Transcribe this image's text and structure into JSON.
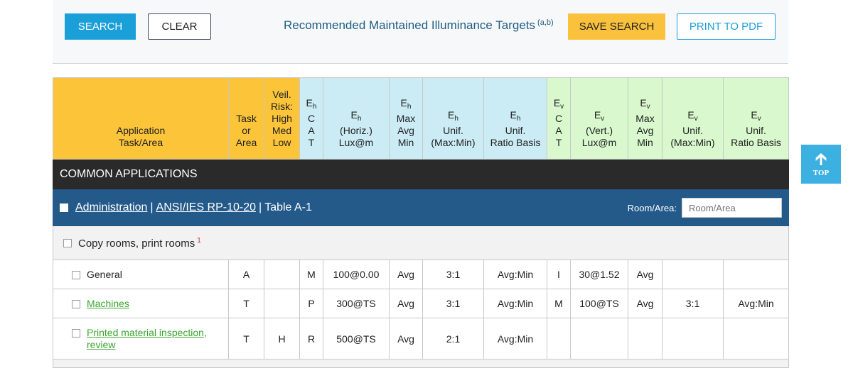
{
  "toolbar": {
    "search_label": "SEARCH",
    "clear_label": "CLEAR",
    "title": "Recommended Maintained Illuminance Targets",
    "title_note": "(a,b)",
    "save_label": "SAVE SEARCH",
    "print_label": "PRINT TO PDF"
  },
  "headers": {
    "application": [
      "Application",
      "Task/Area"
    ],
    "task_area": [
      "Task",
      "or",
      "Area"
    ],
    "veil_risk": [
      "Veil.",
      "Risk:",
      "High",
      "Med",
      "Low"
    ],
    "eh_cat": {
      "sym": "E",
      "sub": "h",
      "lines": [
        "C",
        "A",
        "T"
      ]
    },
    "eh_lux": {
      "sym": "E",
      "sub": "h",
      "lines": [
        "(Horiz.)",
        "Lux@m"
      ]
    },
    "eh_maxavg": {
      "sym": "E",
      "sub": "h",
      "lines": [
        "Max",
        "Avg",
        "Min"
      ]
    },
    "eh_unif": {
      "sym": "E",
      "sub": "h",
      "lines": [
        "Unif.",
        "(Max:Min)"
      ]
    },
    "eh_ratio": {
      "sym": "E",
      "sub": "h",
      "lines": [
        "Unif.",
        "Ratio Basis"
      ]
    },
    "ev_cat": {
      "sym": "E",
      "sub": "v",
      "lines": [
        "C",
        "A",
        "T"
      ]
    },
    "ev_lux": {
      "sym": "E",
      "sub": "v",
      "lines": [
        "(Vert.)",
        "Lux@m"
      ]
    },
    "ev_maxavg": {
      "sym": "E",
      "sub": "v",
      "lines": [
        "Max",
        "Avg",
        "Min"
      ]
    },
    "ev_unif": {
      "sym": "E",
      "sub": "v",
      "lines": [
        "Unif.",
        "(Max:Min)"
      ]
    },
    "ev_ratio": {
      "sym": "E",
      "sub": "v",
      "lines": [
        "Unif.",
        "Ratio Basis"
      ]
    }
  },
  "section": {
    "title": "COMMON APPLICATIONS"
  },
  "group": {
    "link1": "Administration",
    "sep1": "|",
    "link2": "ANSI/IES RP-10-20",
    "sep2": "|",
    "table_ref": "Table A-1",
    "room_label": "Room/Area:",
    "room_placeholder": "Room/Area"
  },
  "subgroup": {
    "label": "Copy rooms, print rooms",
    "footnote": "1"
  },
  "rows": [
    {
      "name": "General",
      "link": false,
      "task": "A",
      "veil": "",
      "eh_cat": "M",
      "eh_lux": "100@0.00",
      "eh_maxavg": "Avg",
      "eh_unif": "3:1",
      "eh_ratio": "Avg:Min",
      "ev_cat": "I",
      "ev_lux": "30@1.52",
      "ev_maxavg": "Avg",
      "ev_unif": "",
      "ev_ratio": ""
    },
    {
      "name": "Machines",
      "link": true,
      "task": "T",
      "veil": "",
      "eh_cat": "P",
      "eh_lux": "300@TS",
      "eh_maxavg": "Avg",
      "eh_unif": "3:1",
      "eh_ratio": "Avg:Min",
      "ev_cat": "M",
      "ev_lux": "100@TS",
      "ev_maxavg": "Avg",
      "ev_unif": "3:1",
      "ev_ratio": "Avg:Min"
    },
    {
      "name_lines": [
        "Printed material inspection,",
        "review"
      ],
      "link": true,
      "task": "T",
      "veil": "H",
      "eh_cat": "R",
      "eh_lux": "500@TS",
      "eh_maxavg": "Avg",
      "eh_unif": "2:1",
      "eh_ratio": "Avg:Min",
      "ev_cat": "",
      "ev_lux": "",
      "ev_maxavg": "",
      "ev_unif": "",
      "ev_ratio": ""
    }
  ],
  "top_button": {
    "label": "TOP",
    "icon": "arrow-up-icon"
  },
  "colors": {
    "accent_blue": "#1a9fd9",
    "save_yellow": "#f9c13c",
    "header_orange": "#fcc439",
    "header_blue": "#cbecf5",
    "header_green": "#d9f8cd",
    "group_bar": "#235a8a",
    "section_bar": "#2a2a2a",
    "link_green": "#3aa52f"
  }
}
